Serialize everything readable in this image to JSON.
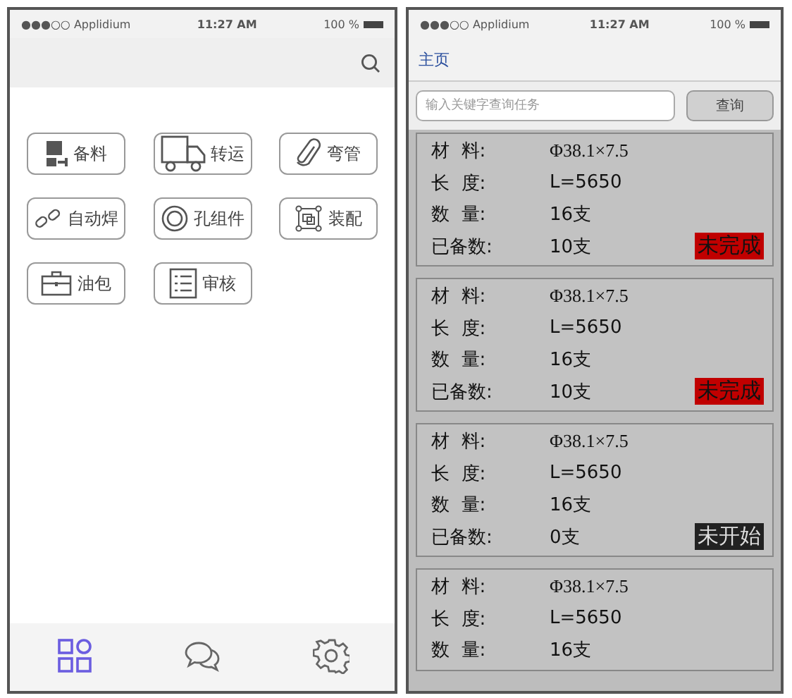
{
  "left_screen": {
    "status_bar": {
      "carrier": "●●●○○ Applidium",
      "time": "11:27 AM",
      "battery": "100 %"
    },
    "menu": [
      {
        "label": "备料"
      },
      {
        "label": "转运"
      },
      {
        "label": "弯管"
      },
      {
        "label": "自动焊"
      },
      {
        "label": "孔组件"
      },
      {
        "label": "装配"
      },
      {
        "label": "油包"
      },
      {
        "label": "审核"
      }
    ],
    "tab_bar": [
      {
        "selected": true
      },
      {
        "selected": false
      },
      {
        "selected": false
      }
    ]
  },
  "right_screen": {
    "status_bar": {
      "carrier": "●●●○○ Applidium",
      "time": "11:27 AM",
      "battery": "100 %"
    },
    "nav_title": "主页",
    "search": {
      "placeholder": "输入关键字查询任务",
      "button": "查询"
    },
    "tasks": [
      {
        "rows": [
          {
            "label": "材  料:",
            "value": "Φ38.1×7.5"
          },
          {
            "label": "长  度:",
            "value": "L=5650"
          },
          {
            "label": "数  量:",
            "value": "16支"
          },
          {
            "label": "已备数:",
            "value": "10支"
          }
        ],
        "status": "未完成",
        "color": "#c00000"
      },
      {
        "rows": [
          {
            "label": "材  料:",
            "value": "Φ38.1×7.5"
          },
          {
            "label": "长  度:",
            "value": "L=5650"
          },
          {
            "label": "数  量:",
            "value": "16支"
          },
          {
            "label": "已备数:",
            "value": "10支"
          }
        ],
        "status": "未完成",
        "color": "#c00000"
      },
      {
        "rows": [
          {
            "label": "材  料:",
            "value": "Φ38.1×7.5"
          },
          {
            "label": "长  度:",
            "value": "L=5650"
          },
          {
            "label": "数  量:",
            "value": "16支"
          },
          {
            "label": "已备数:",
            "value": "0支"
          }
        ],
        "status": "未开始",
        "color": "#222222"
      },
      {
        "rows": [
          {
            "label": "材  料:",
            "value": "Φ38.1×7.5"
          },
          {
            "label": "长  度:",
            "value": "L=5650"
          },
          {
            "label": "数  量:",
            "value": "16支"
          }
        ]
      }
    ]
  }
}
